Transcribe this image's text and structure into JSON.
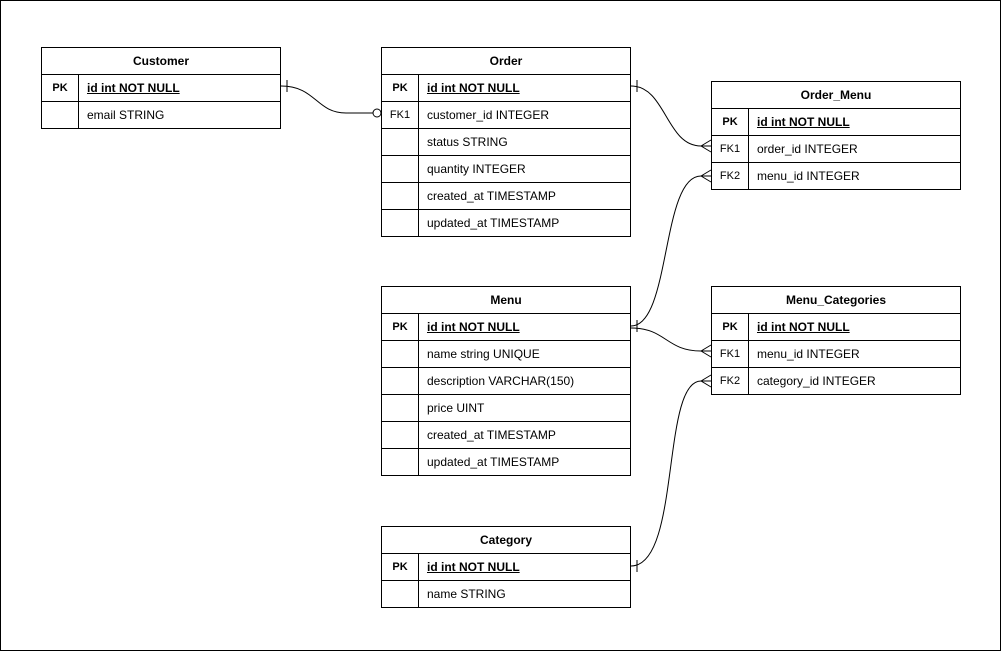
{
  "entities": {
    "customer": {
      "title": "Customer",
      "rows": [
        {
          "key": "PK",
          "field": "id int NOT NULL",
          "pk": true
        },
        {
          "key": "",
          "field": "email STRING"
        }
      ]
    },
    "order": {
      "title": "Order",
      "rows": [
        {
          "key": "PK",
          "field": "id int NOT NULL",
          "pk": true
        },
        {
          "key": "FK1",
          "field": "customer_id INTEGER"
        },
        {
          "key": "",
          "field": "status STRING"
        },
        {
          "key": "",
          "field": "quantity INTEGER"
        },
        {
          "key": "",
          "field": "created_at TIMESTAMP"
        },
        {
          "key": "",
          "field": "updated_at TIMESTAMP"
        }
      ]
    },
    "order_menu": {
      "title": "Order_Menu",
      "rows": [
        {
          "key": "PK",
          "field": "id int NOT NULL",
          "pk": true
        },
        {
          "key": "FK1",
          "field": "order_id INTEGER"
        },
        {
          "key": "FK2",
          "field": "menu_id INTEGER"
        }
      ]
    },
    "menu": {
      "title": "Menu",
      "rows": [
        {
          "key": "PK",
          "field": "id int NOT NULL",
          "pk": true
        },
        {
          "key": "",
          "field": "name string UNIQUE"
        },
        {
          "key": "",
          "field": "description VARCHAR(150)"
        },
        {
          "key": "",
          "field": "price UINT"
        },
        {
          "key": "",
          "field": "created_at TIMESTAMP"
        },
        {
          "key": "",
          "field": "updated_at TIMESTAMP"
        }
      ]
    },
    "menu_categories": {
      "title": "Menu_Categories",
      "rows": [
        {
          "key": "PK",
          "field": "id int NOT NULL",
          "pk": true
        },
        {
          "key": "FK1",
          "field": "menu_id INTEGER"
        },
        {
          "key": "FK2",
          "field": "category_id INTEGER"
        }
      ]
    },
    "category": {
      "title": "Category",
      "rows": [
        {
          "key": "PK",
          "field": "id int NOT NULL",
          "pk": true
        },
        {
          "key": "",
          "field": "name STRING"
        }
      ]
    }
  },
  "chart_data": {
    "type": "er-diagram",
    "entities": [
      {
        "name": "Customer",
        "fields": [
          {
            "key": "PK",
            "name": "id",
            "type": "int",
            "constraint": "NOT NULL"
          },
          {
            "name": "email",
            "type": "STRING"
          }
        ]
      },
      {
        "name": "Order",
        "fields": [
          {
            "key": "PK",
            "name": "id",
            "type": "int",
            "constraint": "NOT NULL"
          },
          {
            "key": "FK1",
            "name": "customer_id",
            "type": "INTEGER"
          },
          {
            "name": "status",
            "type": "STRING"
          },
          {
            "name": "quantity",
            "type": "INTEGER"
          },
          {
            "name": "created_at",
            "type": "TIMESTAMP"
          },
          {
            "name": "updated_at",
            "type": "TIMESTAMP"
          }
        ]
      },
      {
        "name": "Order_Menu",
        "fields": [
          {
            "key": "PK",
            "name": "id",
            "type": "int",
            "constraint": "NOT NULL"
          },
          {
            "key": "FK1",
            "name": "order_id",
            "type": "INTEGER"
          },
          {
            "key": "FK2",
            "name": "menu_id",
            "type": "INTEGER"
          }
        ]
      },
      {
        "name": "Menu",
        "fields": [
          {
            "key": "PK",
            "name": "id",
            "type": "int",
            "constraint": "NOT NULL"
          },
          {
            "name": "name",
            "type": "string",
            "constraint": "UNIQUE"
          },
          {
            "name": "description",
            "type": "VARCHAR(150)"
          },
          {
            "name": "price",
            "type": "UINT"
          },
          {
            "name": "created_at",
            "type": "TIMESTAMP"
          },
          {
            "name": "updated_at",
            "type": "TIMESTAMP"
          }
        ]
      },
      {
        "name": "Menu_Categories",
        "fields": [
          {
            "key": "PK",
            "name": "id",
            "type": "int",
            "constraint": "NOT NULL"
          },
          {
            "key": "FK1",
            "name": "menu_id",
            "type": "INTEGER"
          },
          {
            "key": "FK2",
            "name": "category_id",
            "type": "INTEGER"
          }
        ]
      },
      {
        "name": "Category",
        "fields": [
          {
            "key": "PK",
            "name": "id",
            "type": "int",
            "constraint": "NOT NULL"
          },
          {
            "name": "name",
            "type": "STRING"
          }
        ]
      }
    ],
    "relationships": [
      {
        "from": "Order.customer_id",
        "to": "Customer.id",
        "type": "many-to-one"
      },
      {
        "from": "Order_Menu.order_id",
        "to": "Order.id",
        "type": "many-to-one"
      },
      {
        "from": "Order_Menu.menu_id",
        "to": "Menu.id",
        "type": "many-to-one"
      },
      {
        "from": "Menu_Categories.menu_id",
        "to": "Menu.id",
        "type": "many-to-one"
      },
      {
        "from": "Menu_Categories.category_id",
        "to": "Category.id",
        "type": "many-to-one"
      }
    ]
  }
}
